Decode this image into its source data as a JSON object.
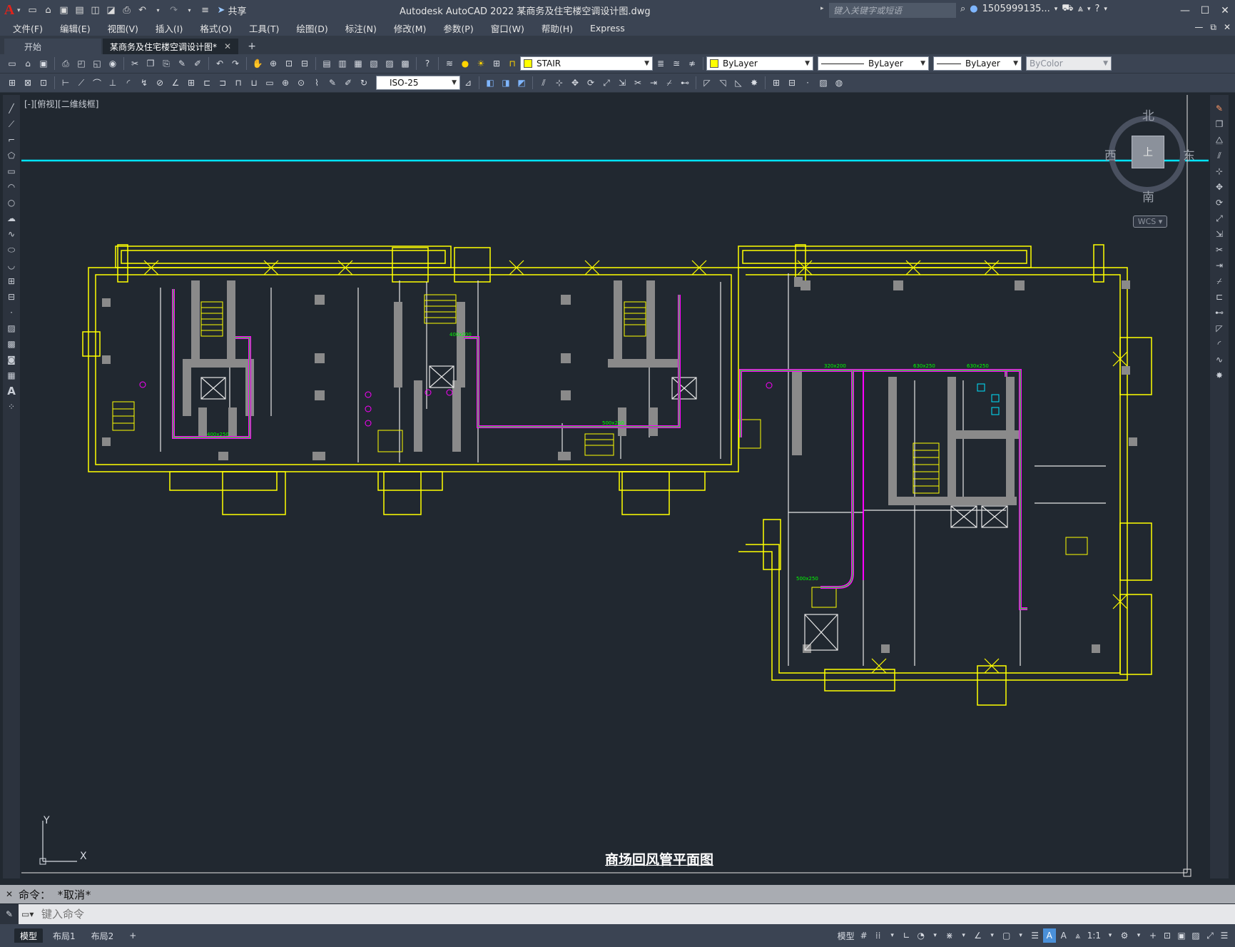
{
  "app": {
    "title": "Autodesk AutoCAD 2022    某商务及住宅楼空调设计图.dwg",
    "logo": "A",
    "share_label": "共享",
    "search_placeholder": "键入关键字或短语",
    "user": "1505999135...",
    "window_controls": [
      "—",
      "☐",
      "✕"
    ]
  },
  "menu": {
    "items": [
      "文件(F)",
      "编辑(E)",
      "视图(V)",
      "插入(I)",
      "格式(O)",
      "工具(T)",
      "绘图(D)",
      "标注(N)",
      "修改(M)",
      "参数(P)",
      "窗口(W)",
      "帮助(H)",
      "Express"
    ]
  },
  "tabs": {
    "start": "开始",
    "document": "某商务及住宅楼空调设计图*",
    "close_glyph": "✕",
    "add_glyph": "+"
  },
  "toolbar": {
    "layer": "STAIR",
    "color": "ByLayer",
    "linetype": "ByLayer",
    "lineweight": "ByLayer",
    "plotstyle": "ByColor",
    "dimstyle": "ISO-25"
  },
  "viewport": {
    "label": "[-][俯视][二维线框]",
    "compass": {
      "north": "北",
      "south": "南",
      "east": "东",
      "west": "西",
      "top": "上"
    },
    "wcs": "WCS ▾",
    "drawing_title": "商场回风管平面图",
    "ucs_y": "Y",
    "ucs_x": "X",
    "duct_labels": [
      "400x200",
      "320x200",
      "630x250",
      "630x250",
      "500x250",
      "400x250",
      "500x250"
    ],
    "colors": {
      "walls": "#ffff00",
      "columns": "#8a8a8a",
      "duct": "#00ff00",
      "duct_edge": "#ff00ff",
      "crosshair": "#00e5ff",
      "fixtures": "#00e5ff"
    }
  },
  "command": {
    "history": "命令： *取消*",
    "placeholder": "键入命令"
  },
  "layout_tabs": [
    "模型",
    "布局1",
    "布局2",
    "+"
  ],
  "status": {
    "model": "模型",
    "scale": "1:1"
  }
}
